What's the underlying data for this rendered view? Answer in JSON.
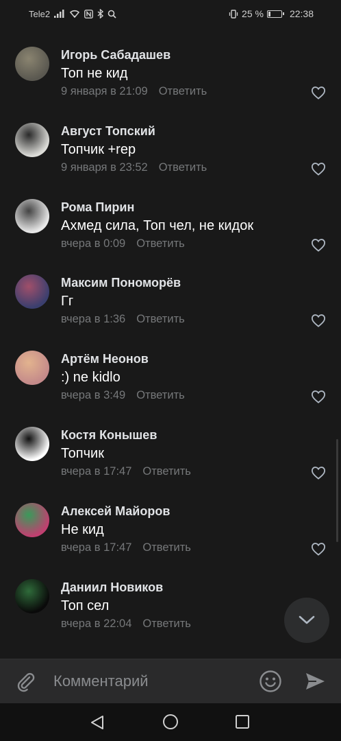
{
  "status_bar": {
    "carrier": "Tele2",
    "battery": "25 %",
    "battery_level": 0.25,
    "time": "22:38"
  },
  "comments": [
    {
      "author": "Игорь Сабадашев",
      "text": "Топ не кид",
      "date": "9 января в 21:09",
      "reply": "Ответить",
      "avatar_colors": [
        "#5a5850",
        "#8a8470"
      ]
    },
    {
      "author": "Август Топский",
      "text": "Топчик +rep",
      "date": "9 января в 23:52",
      "reply": "Ответить",
      "avatar_colors": [
        "#dcdcd8",
        "#2a2a2a"
      ]
    },
    {
      "author": "Рома Пирин",
      "text": "Ахмед сила, Топ чел, не кидок",
      "date": "вчера в 0:09",
      "reply": "Ответить",
      "avatar_colors": [
        "#e8e8e8",
        "#444444"
      ]
    },
    {
      "author": "Максим Пономорёв",
      "text": "Гг",
      "date": "вчера в 1:36",
      "reply": "Ответить",
      "avatar_colors": [
        "#3b3f6e",
        "#a04f6a"
      ]
    },
    {
      "author": "Артём Неонов",
      "text": ":) ne kidlo",
      "date": "вчера в 3:49",
      "reply": "Ответить",
      "avatar_colors": [
        "#c48a8a",
        "#e2b38e"
      ]
    },
    {
      "author": "Костя Конышев",
      "text": "Топчик",
      "date": "вчера в 17:47",
      "reply": "Ответить",
      "avatar_colors": [
        "#ffffff",
        "#111111"
      ]
    },
    {
      "author": "Алексей Майоров",
      "text": "Не кид",
      "date": "вчера в 17:47",
      "reply": "Ответить",
      "avatar_colors": [
        "#c04070",
        "#3a9a5a"
      ]
    },
    {
      "author": "Даниил Новиков",
      "text": "Топ сел",
      "date": "вчера в 22:04",
      "reply": "Ответить",
      "avatar_colors": [
        "#0a0a0a",
        "#2f6b3a"
      ]
    }
  ],
  "composer": {
    "placeholder": "Комментарий"
  },
  "icons": {
    "attach": "paperclip-icon",
    "emoji": "smiley-icon",
    "send": "send-icon",
    "like": "heart-icon",
    "scroll_down": "chevron-down-icon",
    "nav_back": "triangle-back-icon",
    "nav_home": "circle-home-icon",
    "nav_recent": "square-recent-icon"
  },
  "colors": {
    "background": "#191919",
    "text_primary": "#e1e3e6",
    "text_secondary": "#76787a",
    "composer_bg": "#2a2a2b",
    "navbar_bg": "#111111"
  }
}
